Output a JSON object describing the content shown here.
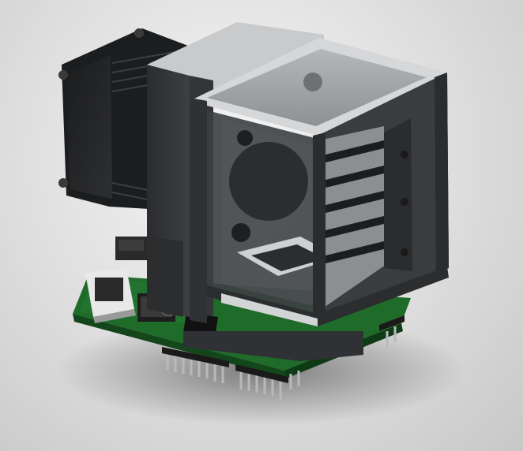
{
  "scene": {
    "subject": "3d-render-enclosure-with-fan-on-pcb",
    "colors": {
      "background": "#dcdcdc",
      "enclosure_dark": "#2b2d2f",
      "enclosure_mid": "#3a3c3f",
      "frame_light": "#cfd0d2",
      "glass": "#9fa3a6",
      "pcb_green": "#1f6b2a",
      "pin_metal": "#b9b9b9",
      "accent_red": "#c8322b"
    }
  }
}
